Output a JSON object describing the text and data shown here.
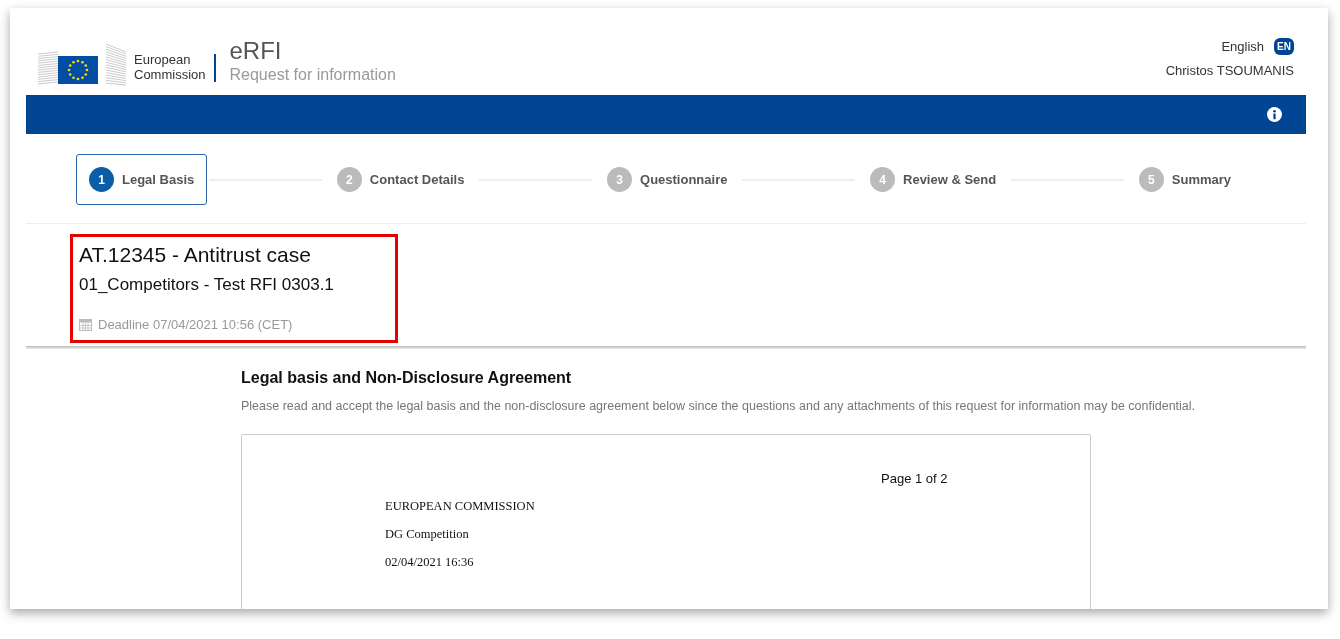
{
  "header": {
    "org_line1": "European",
    "org_line2": "Commission",
    "app_name": "eRFI",
    "app_subtitle": "Request for information",
    "language": "English",
    "language_badge": "EN",
    "user": "Christos TSOUMANIS"
  },
  "steps": [
    {
      "number": "1",
      "label": "Legal Basis",
      "selected": true
    },
    {
      "number": "2",
      "label": "Contact Details",
      "selected": false
    },
    {
      "number": "3",
      "label": "Questionnaire",
      "selected": false
    },
    {
      "number": "4",
      "label": "Review & Send",
      "selected": false
    },
    {
      "number": "5",
      "label": "Summary",
      "selected": false
    }
  ],
  "case": {
    "title": "AT.12345 - Antitrust case",
    "subtitle": "01_Competitors - Test RFI 0303.1",
    "deadline": "Deadline 07/04/2021 10:56 (CET)"
  },
  "section": {
    "heading": "Legal basis and Non-Disclosure Agreement",
    "intro": "Please read and accept the legal basis and the non-disclosure agreement below since the questions and any attachments of this request for information may be confidential."
  },
  "document": {
    "page": "Page 1 of 2",
    "lines": [
      "EUROPEAN COMMISSION",
      "DG Competition",
      "02/04/2021 16:36"
    ]
  }
}
